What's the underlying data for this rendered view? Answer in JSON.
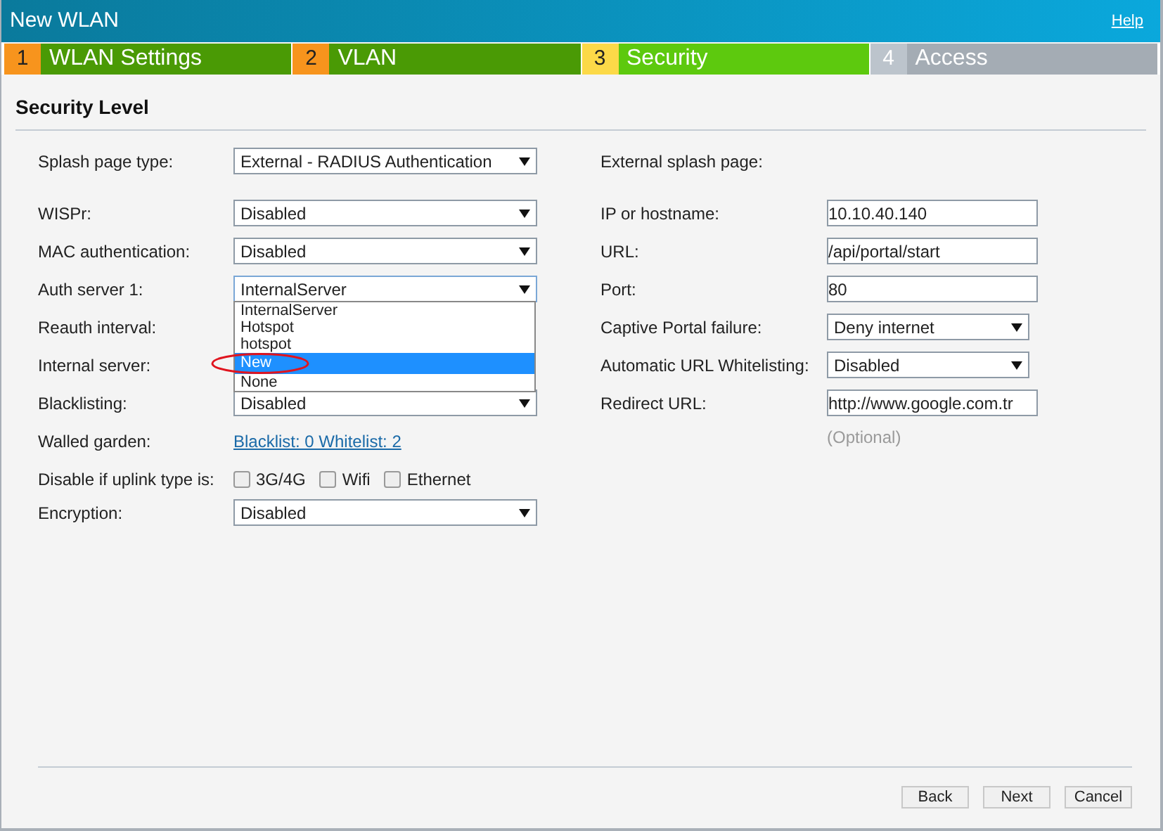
{
  "window": {
    "title": "New WLAN",
    "help": "Help"
  },
  "steps": [
    {
      "number": "1",
      "label": "WLAN Settings",
      "kind": "done"
    },
    {
      "number": "2",
      "label": "VLAN",
      "kind": "done"
    },
    {
      "number": "3",
      "label": "Security",
      "kind": "current"
    },
    {
      "number": "4",
      "label": "Access",
      "kind": "pending"
    }
  ],
  "section_title": "Security Level",
  "left_fields": [
    {
      "label": "Splash page type:",
      "kind": "select",
      "value": "External - RADIUS Authentication"
    },
    {
      "label": "WISPr:",
      "kind": "select",
      "value": "Disabled"
    },
    {
      "label": "MAC authentication:",
      "kind": "select",
      "value": "Disabled"
    },
    {
      "label": "Auth server 1:",
      "kind": "open_select",
      "value": "InternalServer"
    },
    {
      "label": "Reauth interval:",
      "kind": "covered"
    },
    {
      "label": "Internal server:",
      "kind": "covered"
    },
    {
      "label": "Blacklisting:",
      "kind": "select",
      "value": "Disabled"
    },
    {
      "label": "Walled garden:",
      "kind": "link",
      "value": "Blacklist: 0 Whitelist: 2"
    },
    {
      "label": "Disable if uplink type is:",
      "kind": "checkboxes",
      "options": [
        {
          "label": "3G/4G",
          "checked": false
        },
        {
          "label": "Wifi",
          "checked": false
        },
        {
          "label": "Ethernet",
          "checked": false
        }
      ]
    },
    {
      "label": "Encryption:",
      "kind": "select",
      "value": "Disabled"
    }
  ],
  "dropdown_options": [
    {
      "label": "InternalServer",
      "selected": false
    },
    {
      "label": "Hotspot",
      "selected": false
    },
    {
      "label": "hotspot",
      "selected": false
    },
    {
      "label": "New",
      "selected": true
    },
    {
      "label": "None",
      "selected": false
    }
  ],
  "right_fields": [
    {
      "label": "External splash page:",
      "kind": "heading"
    },
    {
      "label": "IP or hostname:",
      "kind": "input",
      "value": "10.10.40.140"
    },
    {
      "label": "URL:",
      "kind": "input",
      "value": "/api/portal/start"
    },
    {
      "label": "Port:",
      "kind": "input",
      "value": "80"
    },
    {
      "label": "Captive Portal failure:",
      "kind": "select",
      "value": "Deny internet"
    },
    {
      "label": "Automatic URL Whitelisting:",
      "kind": "select",
      "value": "Disabled"
    },
    {
      "label": "Redirect URL:",
      "kind": "input",
      "value": "http://www.google.com.tr"
    },
    {
      "kind": "hint",
      "value": "(Optional)"
    }
  ],
  "buttons": [
    "Back",
    "Next",
    "Cancel"
  ]
}
